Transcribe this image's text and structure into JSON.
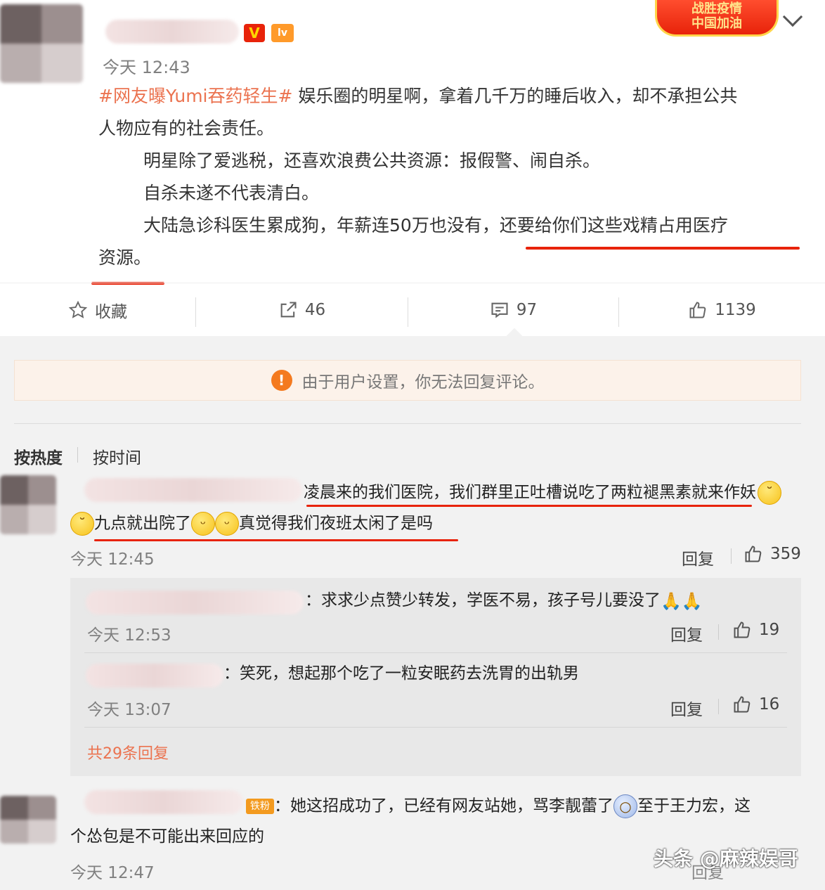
{
  "post": {
    "time": "今天 12:43",
    "verified_badge": "V",
    "level_badge": "lv",
    "promo_line1": "战胜疫情",
    "promo_line2": "中国加油",
    "hashtag": "#网友曝Yumi吞药轻生#",
    "line1": " 娱乐圈的明星啊，拿着几千万的睡后收入，却不承担公共",
    "line2": "人物应有的社会责任。",
    "line3": "明星除了爱逃税，还喜欢浪费公共资源：报假警、闹自杀。",
    "line4": "自杀未遂不代表清白。",
    "line5": "大陆急诊科医生累成狗，年薪连50万也没有，还要给你们这些戏精占用医疗",
    "line6": "资源。"
  },
  "toolbar": {
    "favorite_label": "收藏",
    "repost_count": "46",
    "comment_count": "97",
    "like_count": "1139"
  },
  "notice": {
    "icon": "!",
    "text": "由于用户设置，你无法回复评论。"
  },
  "sort": {
    "hot": "按热度",
    "time": "按时间"
  },
  "comments": [
    {
      "line1": "凌晨来的我们医院，我们群里正吐槽说吃了两粒褪黑素就来作妖",
      "line2a": "九点就出院了",
      "line2b": "真觉得我们夜班太闲了是吗",
      "time": "今天 12:45",
      "reply_label": "回复",
      "likes": "359"
    },
    {
      "badge": "铁粉",
      "line1": "：她这招成功了，已经有网友站她，骂李靓蕾了",
      "line1b": "至于王力宏，这",
      "line2": "个怂包是不可能出来回应的",
      "time": "今天 12:47",
      "reply_label": "回复"
    }
  ],
  "replies": [
    {
      "text": "：求求少点赞少转发，学医不易，孩子号儿要没了",
      "time": "今天 12:53",
      "reply_label": "回复",
      "likes": "19"
    },
    {
      "text": "：笑死，想起那个吃了一粒安眠药去洗胃的出轨男",
      "time": "今天 13:07",
      "reply_label": "回复",
      "likes": "16"
    }
  ],
  "more_replies": "共29条回复",
  "watermark": "头条 @麻辣娱哥",
  "colors": {
    "accent_red": "#e8230a",
    "hashtag_orange": "#eb7350",
    "notice_bg": "#fcf2ea"
  }
}
